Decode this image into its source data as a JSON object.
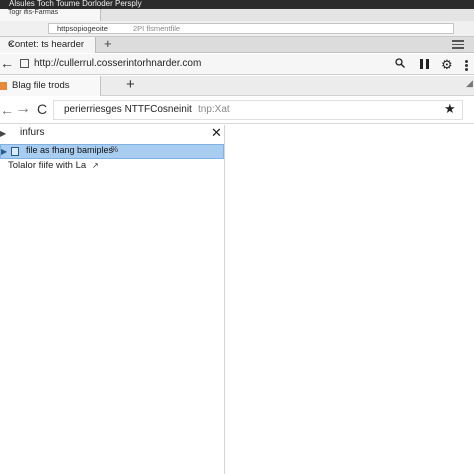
{
  "outer_window": {
    "title": "Alsules Toch Toume Dorloder Persply",
    "tab_label": "Togr ifis-Farmas",
    "url": "httpsopiogeoite",
    "url_extra": "2PI flsmentfile"
  },
  "mid_window": {
    "tab_label": "Contet: ts hearder",
    "tab_close": "×",
    "new_tab": "+",
    "back": "←",
    "url": "http://cullerrul.cosserintorhnarder.com",
    "gear": "⚙"
  },
  "inner_window": {
    "tab_label": "Blag file trods",
    "new_tab": "+",
    "corner": "◢",
    "back": "←",
    "forward": "→",
    "reload": "C",
    "url": "perierriesges NTTFCosneinit",
    "url_placeholder": "tnp:Xat",
    "star": "★"
  },
  "side_panel": {
    "find_arrow": "▶",
    "find_label": "infurs",
    "close": "✕",
    "selected_item": "file as fhang bamiples",
    "selected_badge": "%",
    "selected_arrow": "▶",
    "list_item": "Tolalor fiife with La",
    "list_cursor": "↗"
  },
  "colors": {
    "title_bar": "#2b2b2b",
    "selection": "#a8cdf0",
    "favicon": "#e8893a"
  }
}
